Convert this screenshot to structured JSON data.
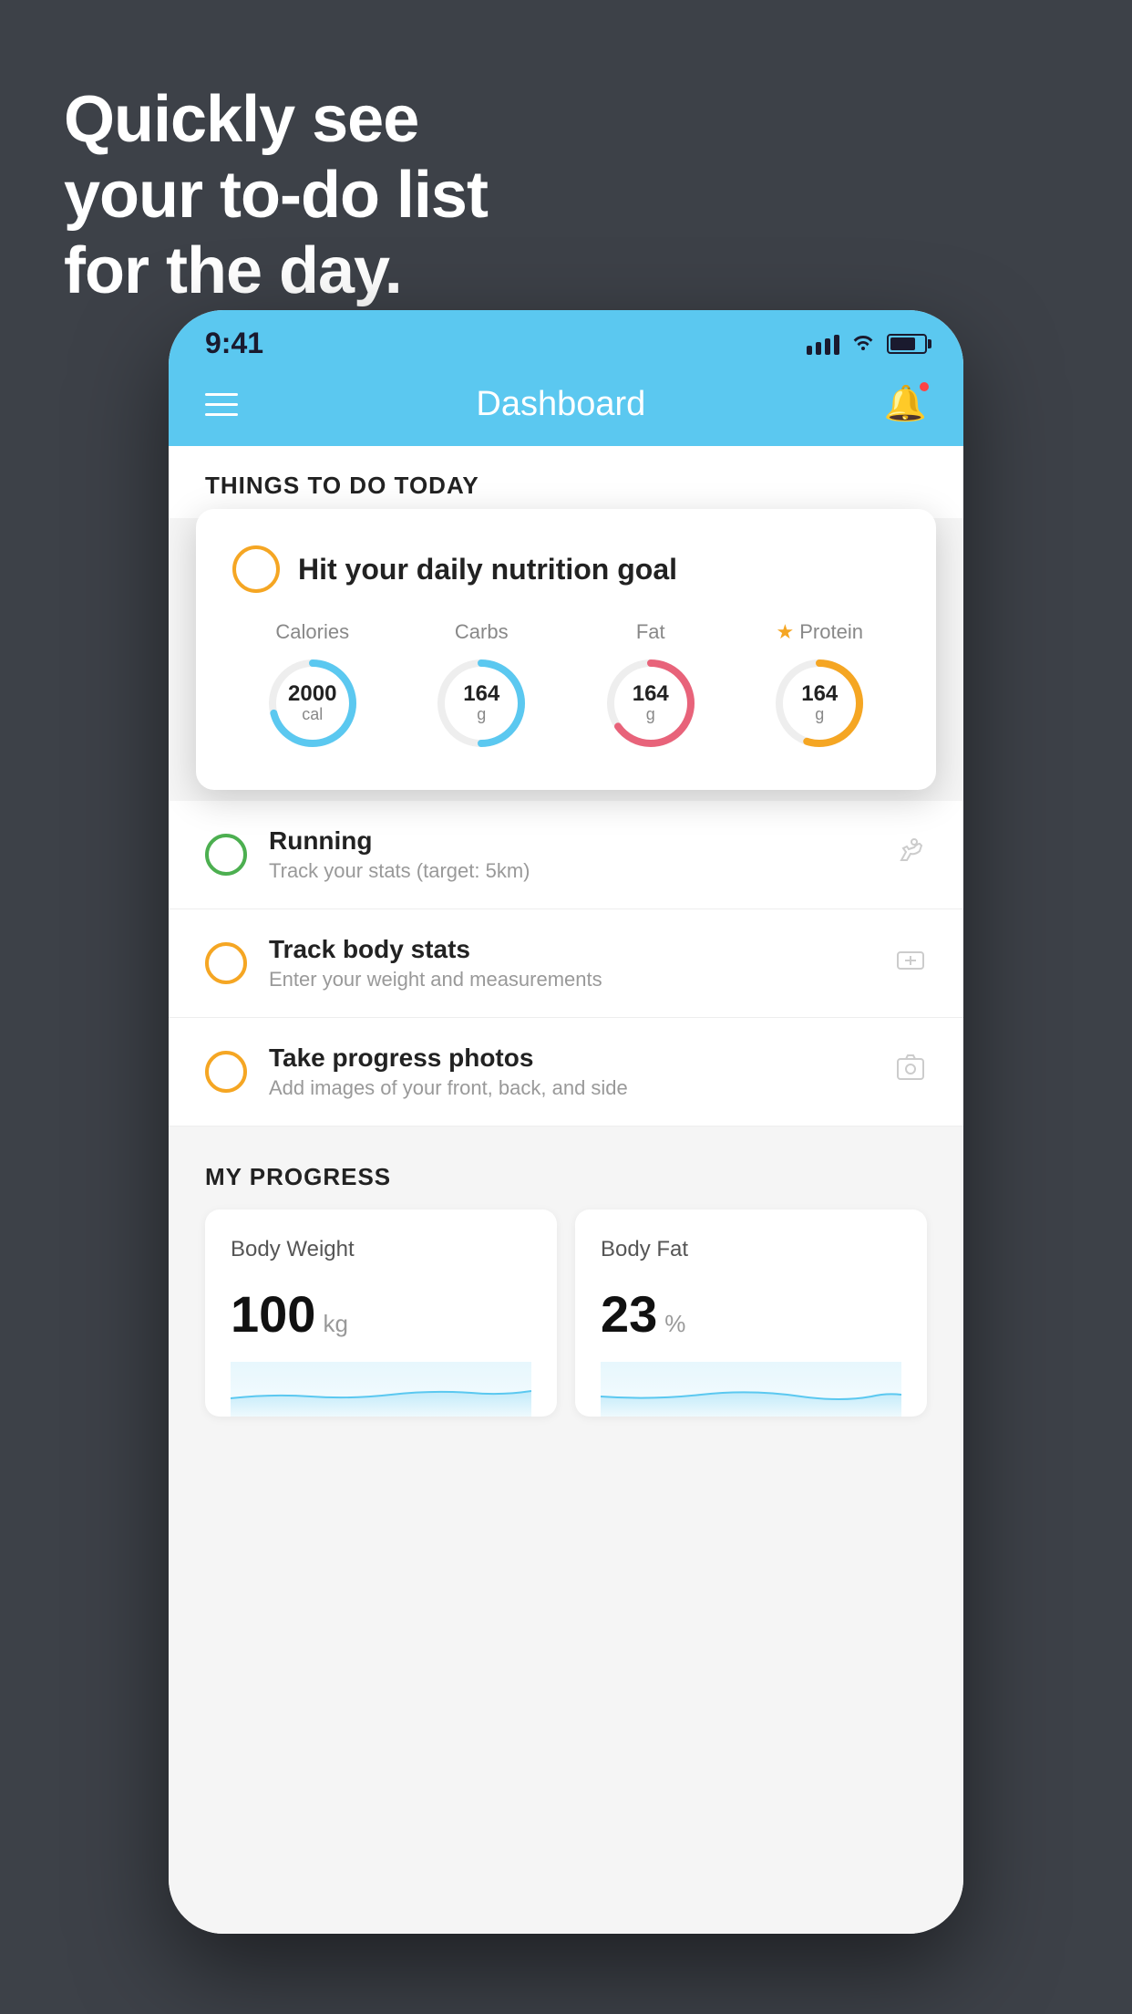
{
  "headline": {
    "line1": "Quickly see",
    "line2": "your to-do list",
    "line3": "for the day."
  },
  "statusBar": {
    "time": "9:41",
    "signalBars": [
      8,
      12,
      16,
      20
    ],
    "batteryPercent": 75
  },
  "navBar": {
    "title": "Dashboard",
    "notificationDot": true
  },
  "thingsToDoSection": {
    "title": "THINGS TO DO TODAY"
  },
  "featuredCard": {
    "circleColor": "#f5a623",
    "title": "Hit your daily nutrition goal",
    "columns": [
      {
        "label": "Calories",
        "starred": false,
        "value": "2000",
        "unit": "cal",
        "color": "#5bc8f0",
        "progress": 0.7
      },
      {
        "label": "Carbs",
        "starred": false,
        "value": "164",
        "unit": "g",
        "color": "#5bc8f0",
        "progress": 0.5
      },
      {
        "label": "Fat",
        "starred": false,
        "value": "164",
        "unit": "g",
        "color": "#e8637a",
        "progress": 0.65
      },
      {
        "label": "Protein",
        "starred": true,
        "value": "164",
        "unit": "g",
        "color": "#f5a623",
        "progress": 0.55
      }
    ]
  },
  "todoItems": [
    {
      "id": "running",
      "name": "Running",
      "desc": "Track your stats (target: 5km)",
      "circleColor": "green",
      "icon": "👟"
    },
    {
      "id": "track-body-stats",
      "name": "Track body stats",
      "desc": "Enter your weight and measurements",
      "circleColor": "yellow",
      "icon": "⚖️"
    },
    {
      "id": "progress-photos",
      "name": "Take progress photos",
      "desc": "Add images of your front, back, and side",
      "circleColor": "yellow",
      "icon": "🖼️"
    }
  ],
  "progressSection": {
    "title": "MY PROGRESS",
    "cards": [
      {
        "id": "body-weight",
        "title": "Body Weight",
        "value": "100",
        "unit": "kg",
        "chartColor": "#5bc8f0"
      },
      {
        "id": "body-fat",
        "title": "Body Fat",
        "value": "23",
        "unit": "%",
        "chartColor": "#5bc8f0"
      }
    ]
  }
}
